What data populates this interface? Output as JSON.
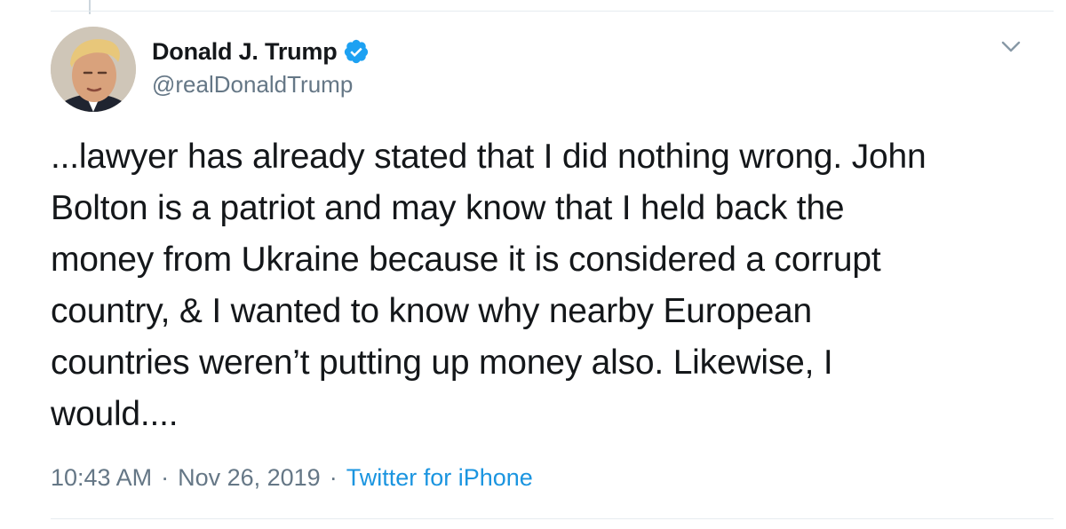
{
  "tweet": {
    "author": {
      "display_name": "Donald J. Trump",
      "handle": "@realDonaldTrump",
      "verified": true,
      "avatar_icon": "profile-photo"
    },
    "text": "...lawyer has already stated that I did nothing wrong. John\nBolton is a patriot and may know that I held back the\nmoney from Ukraine because it is considered a corrupt\ncountry, & I wanted to know why nearby European\ncountries weren’t putting up money also. Likewise, I\nwould....",
    "time": "10:43 AM",
    "separator": "·",
    "date": "Nov 26, 2019",
    "source": "Twitter for iPhone",
    "menu_icon": "chevron-down-icon"
  },
  "colors": {
    "text_primary": "#14171a",
    "text_secondary": "#657786",
    "link": "#1b95e0",
    "verified_badge": "#1da1f2",
    "border": "#e6ecf0"
  }
}
